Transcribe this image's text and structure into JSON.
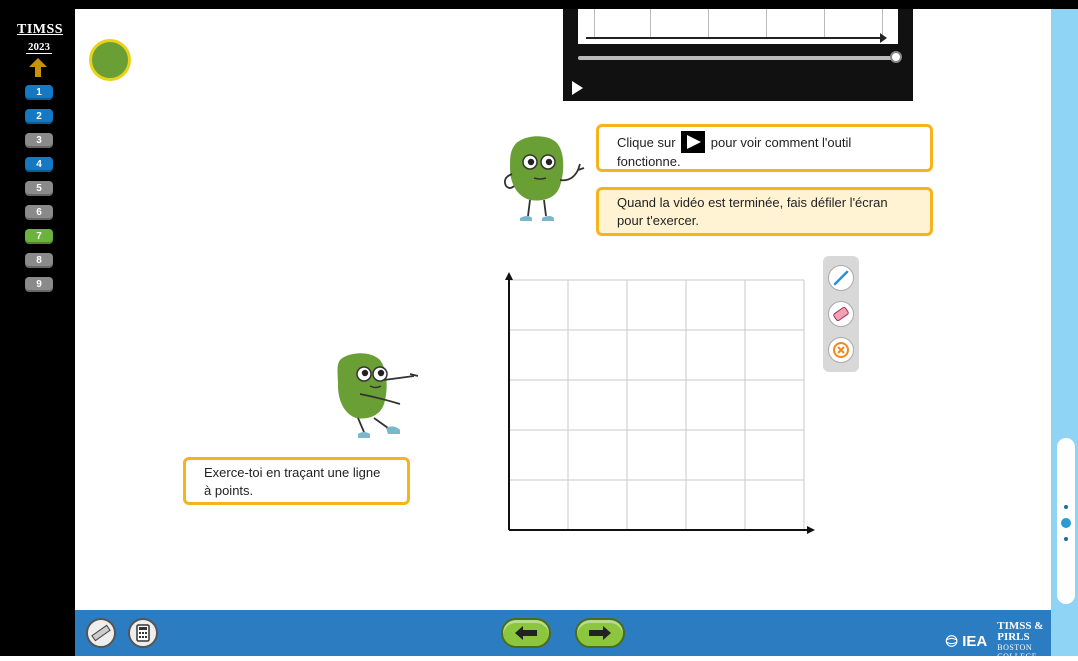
{
  "sidebar": {
    "logo_line1": "TIMSS",
    "logo_line2": "2023",
    "questions": [
      {
        "label": "1",
        "state": "blue"
      },
      {
        "label": "2",
        "state": "blue"
      },
      {
        "label": "3",
        "state": "gray"
      },
      {
        "label": "4",
        "state": "blue"
      },
      {
        "label": "5",
        "state": "gray"
      },
      {
        "label": "6",
        "state": "gray"
      },
      {
        "label": "7",
        "state": "green"
      },
      {
        "label": "8",
        "state": "gray"
      },
      {
        "label": "9",
        "state": "gray"
      }
    ]
  },
  "video": {
    "progress": 1.0
  },
  "instructions": {
    "click_prefix": "Clique sur",
    "click_suffix": "pour voir comment l'outil fonctionne.",
    "scroll_text": "Quand la vidéo est terminée, fais défiler l'écran pour t'exercer.",
    "practice_text": "Exerce-toi en traçant une ligne à points."
  },
  "toolbar": {
    "tools": [
      "pencil-icon",
      "eraser-icon",
      "clear-icon"
    ]
  },
  "footer": {
    "brand_iea": "IEA",
    "brand_line1": "TIMSS & PIRLS",
    "brand_line2": "BOSTON COLLEGE"
  },
  "colors": {
    "sidebar": "#000000",
    "footer": "#2c7cc1",
    "accent_border": "#f6b31b",
    "nav_green": "#8cc63f",
    "right_bar": "#8fd3f5"
  }
}
